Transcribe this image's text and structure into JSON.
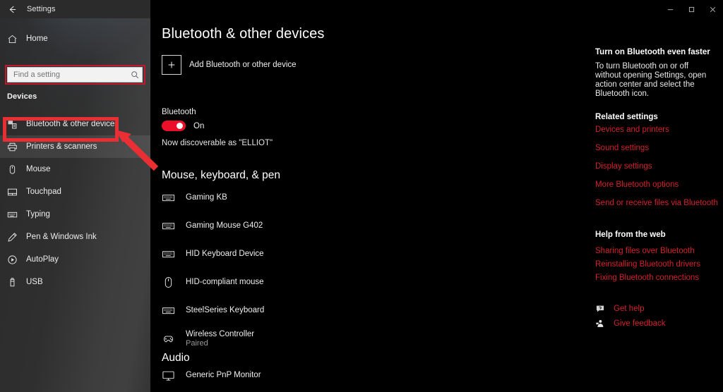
{
  "window": {
    "title": "Settings",
    "back_icon": "back-arrow-icon",
    "minimize_label": "Minimize",
    "maximize_label": "Restore",
    "close_label": "Close"
  },
  "sidebar": {
    "home": {
      "label": "Home",
      "icon": "home-icon"
    },
    "search": {
      "placeholder": "Find a setting",
      "value": "",
      "icon": "search-icon"
    },
    "section": "Devices",
    "items": [
      {
        "label": "Bluetooth & other devices",
        "icon": "bluetooth-devices-icon",
        "state": "normal"
      },
      {
        "label": "Printers & scanners",
        "icon": "printer-icon",
        "state": "hover"
      },
      {
        "label": "Mouse",
        "icon": "mouse-icon",
        "state": "normal"
      },
      {
        "label": "Touchpad",
        "icon": "touchpad-icon",
        "state": "normal"
      },
      {
        "label": "Typing",
        "icon": "keyboard-icon",
        "state": "normal"
      },
      {
        "label": "Pen & Windows Ink",
        "icon": "pen-icon",
        "state": "normal"
      },
      {
        "label": "AutoPlay",
        "icon": "autoplay-icon",
        "state": "normal"
      },
      {
        "label": "USB",
        "icon": "usb-icon",
        "state": "normal"
      }
    ]
  },
  "annotations": {
    "highlight_color": "#ea2f34",
    "search_ring_color": "#c0182c",
    "target_label": "Printers & scanners"
  },
  "main": {
    "title": "Bluetooth & other devices",
    "add_device": {
      "label": "Add Bluetooth or other device",
      "icon": "plus-icon"
    },
    "bluetooth": {
      "label": "Bluetooth",
      "state": "On",
      "toggle_on": true,
      "toggle_color": "#ec0f2a",
      "discoverable": "Now discoverable as \"ELLIOT\""
    },
    "groups": [
      {
        "title": "Mouse, keyboard, & pen",
        "devices": [
          {
            "name": "Gaming KB",
            "status": "",
            "icon": "keyboard-icon"
          },
          {
            "name": "Gaming Mouse G402",
            "status": "",
            "icon": "keyboard-icon"
          },
          {
            "name": "HID Keyboard Device",
            "status": "",
            "icon": "keyboard-icon"
          },
          {
            "name": "HID-compliant mouse",
            "status": "",
            "icon": "mouse-icon"
          },
          {
            "name": "SteelSeries Keyboard",
            "status": "",
            "icon": "keyboard-icon"
          },
          {
            "name": "Wireless Controller",
            "status": "Paired",
            "icon": "gamepad-icon"
          }
        ]
      },
      {
        "title": "Audio",
        "devices": [
          {
            "name": "Generic PnP Monitor",
            "status": "",
            "icon": "monitor-icon"
          }
        ]
      }
    ]
  },
  "rail": {
    "tip_title": "Turn on Bluetooth even faster",
    "tip_body": "To turn Bluetooth on or off without opening Settings, open action center and select the Bluetooth icon.",
    "related_title": "Related settings",
    "related_links": [
      "Devices and printers",
      "Sound settings",
      "Display settings",
      "More Bluetooth options",
      "Send or receive files via Bluetooth"
    ],
    "help_title": "Help from the web",
    "help_links": [
      "Sharing files over Bluetooth",
      "Reinstalling Bluetooth drivers",
      "Fixing Bluetooth connections"
    ],
    "footer": [
      {
        "label": "Get help",
        "icon": "question-bubble-icon"
      },
      {
        "label": "Give feedback",
        "icon": "feedback-person-icon"
      }
    ],
    "link_color": "#d4222c"
  }
}
